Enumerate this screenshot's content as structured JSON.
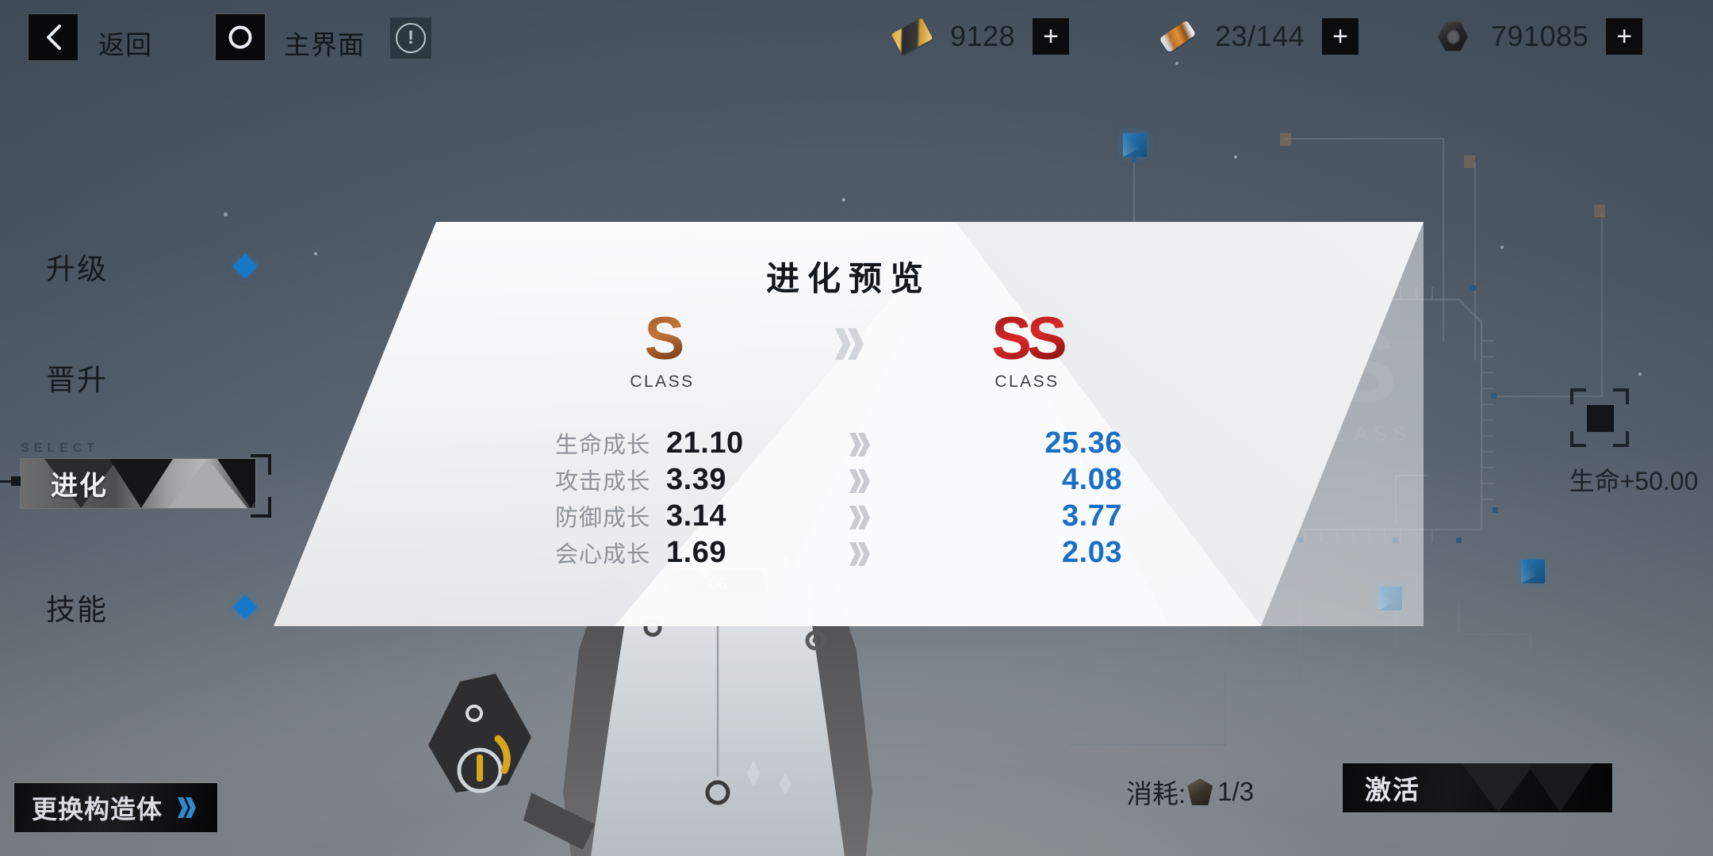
{
  "topbar": {
    "back_label": "返回",
    "back_icon": "chevron-left-icon",
    "home_label": "主界面",
    "home_icon": "circle-icon",
    "info_icon": "exclamation-circle-icon",
    "currencies": [
      {
        "icon": "gold-card-icon",
        "value": "9128",
        "add_label": "+"
      },
      {
        "icon": "serum-vial-icon",
        "value": "23/144",
        "add_label": "+"
      },
      {
        "icon": "hex-nut-icon",
        "value": "791085",
        "add_label": "+"
      }
    ]
  },
  "sidebar": {
    "items": [
      {
        "label": "升级",
        "has_marker": true,
        "active": false
      },
      {
        "label": "晋升",
        "has_marker": false,
        "active": false
      },
      {
        "label": "技能",
        "has_marker": true,
        "active": false
      }
    ],
    "active_item": {
      "select_label": "SELECT",
      "label": "进化"
    },
    "swap_button": {
      "label": "更换构造体",
      "icon": "double-chevron-right-icon"
    }
  },
  "panel": {
    "title": "进化预览",
    "current": {
      "rank": "S",
      "class_label": "CLASS",
      "color": "#8a4a1f"
    },
    "target": {
      "rank": "SS",
      "class_label": "CLASS",
      "color": "#a51b1b"
    },
    "arrow_icon": "double-chevron-right-icon",
    "stats": [
      {
        "label": "生命成长",
        "current": "21.10",
        "next": "25.36"
      },
      {
        "label": "攻击成长",
        "current": "3.39",
        "next": "4.08"
      },
      {
        "label": "防御成长",
        "current": "3.14",
        "next": "3.77"
      },
      {
        "label": "会心成长",
        "current": "1.69",
        "next": "2.03"
      }
    ],
    "next_color": "#1a6fc4"
  },
  "reward_node": {
    "label": "生命+50.00",
    "icon": "targeting-bracket-icon"
  },
  "background": {
    "watermark_rank": "S",
    "watermark_class": "CLASS"
  },
  "footer": {
    "cost_label": "消耗:",
    "cost_icon": "evolution-core-icon",
    "cost_value": "1/3",
    "activate_label": "激活"
  }
}
